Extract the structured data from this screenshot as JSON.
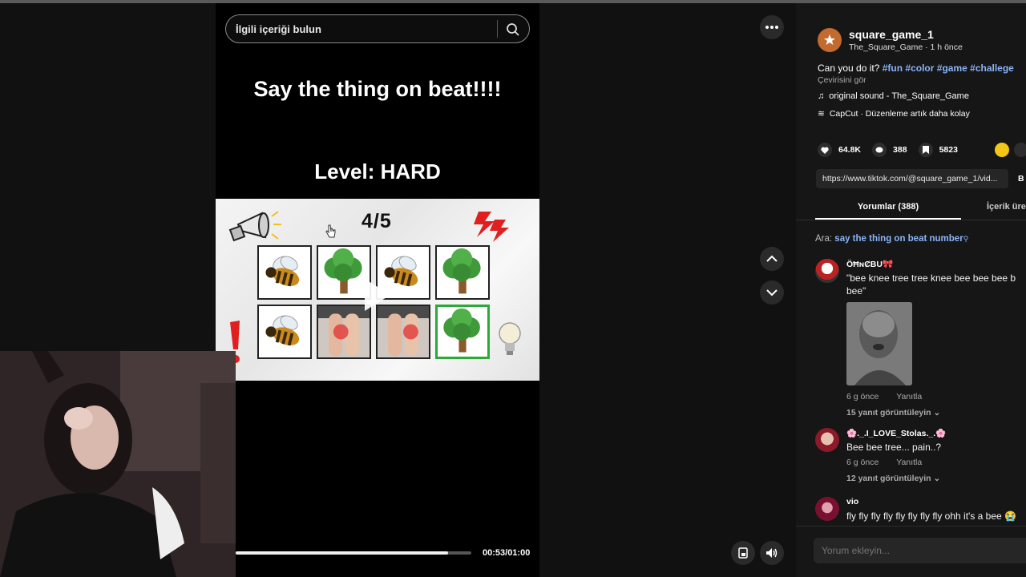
{
  "search": {
    "placeholder": "İlgili içeriği bulun"
  },
  "video": {
    "title": "Say the thing on beat!!!!",
    "level": "Level: HARD",
    "counter": "4/5",
    "progress": 0.9,
    "time": "00:53/01:00"
  },
  "post": {
    "username": "square_game_1",
    "subline": "The_Square_Game · 1 h önce",
    "caption_text": "Can you do it? ",
    "hashtags": [
      "#fun",
      "#color",
      "#game",
      "#challege"
    ],
    "translate": "Çevirisini gör",
    "sound": "original sound - The_Square_Game",
    "capcut": "CapCut · Düzenleme artık daha kolay",
    "likes": "64.8K",
    "comments": "388",
    "saves": "5823",
    "url": "https://www.tiktok.com/@square_game_1/vid...",
    "url_copy": "B"
  },
  "tabs": {
    "comments": "Yorumlar (388)",
    "creator": "İçerik üret"
  },
  "search_suggest": {
    "prefix": "Ara: ",
    "query": "say the thing on beat number"
  },
  "comments": [
    {
      "name": "ÖĦɴȻBU🎀",
      "text_line1": "\"bee knee tree tree knee bee bee bee b",
      "text_line2": "bee\"",
      "time": "6 g önce",
      "reply": "Yanıtla",
      "replies": "15 yanıt görüntüleyin"
    },
    {
      "name": "🌸._.I_LOVE_Stolas._.🌸",
      "text_line1": "Bee bee tree... pain..?",
      "time": "6 g önce",
      "reply": "Yanıtla",
      "replies": "12 yanıt görüntüleyin"
    },
    {
      "name": "vio",
      "text_line1": "fly fly fly fly fly fly fly fly ohh it's a bee 😭"
    }
  ],
  "comment_input": {
    "placeholder": "Yorum ekleyin..."
  },
  "colors": {
    "accent_link": "#8ab4f8",
    "active_cell": "#2da83a",
    "coin": "#f3c617"
  }
}
